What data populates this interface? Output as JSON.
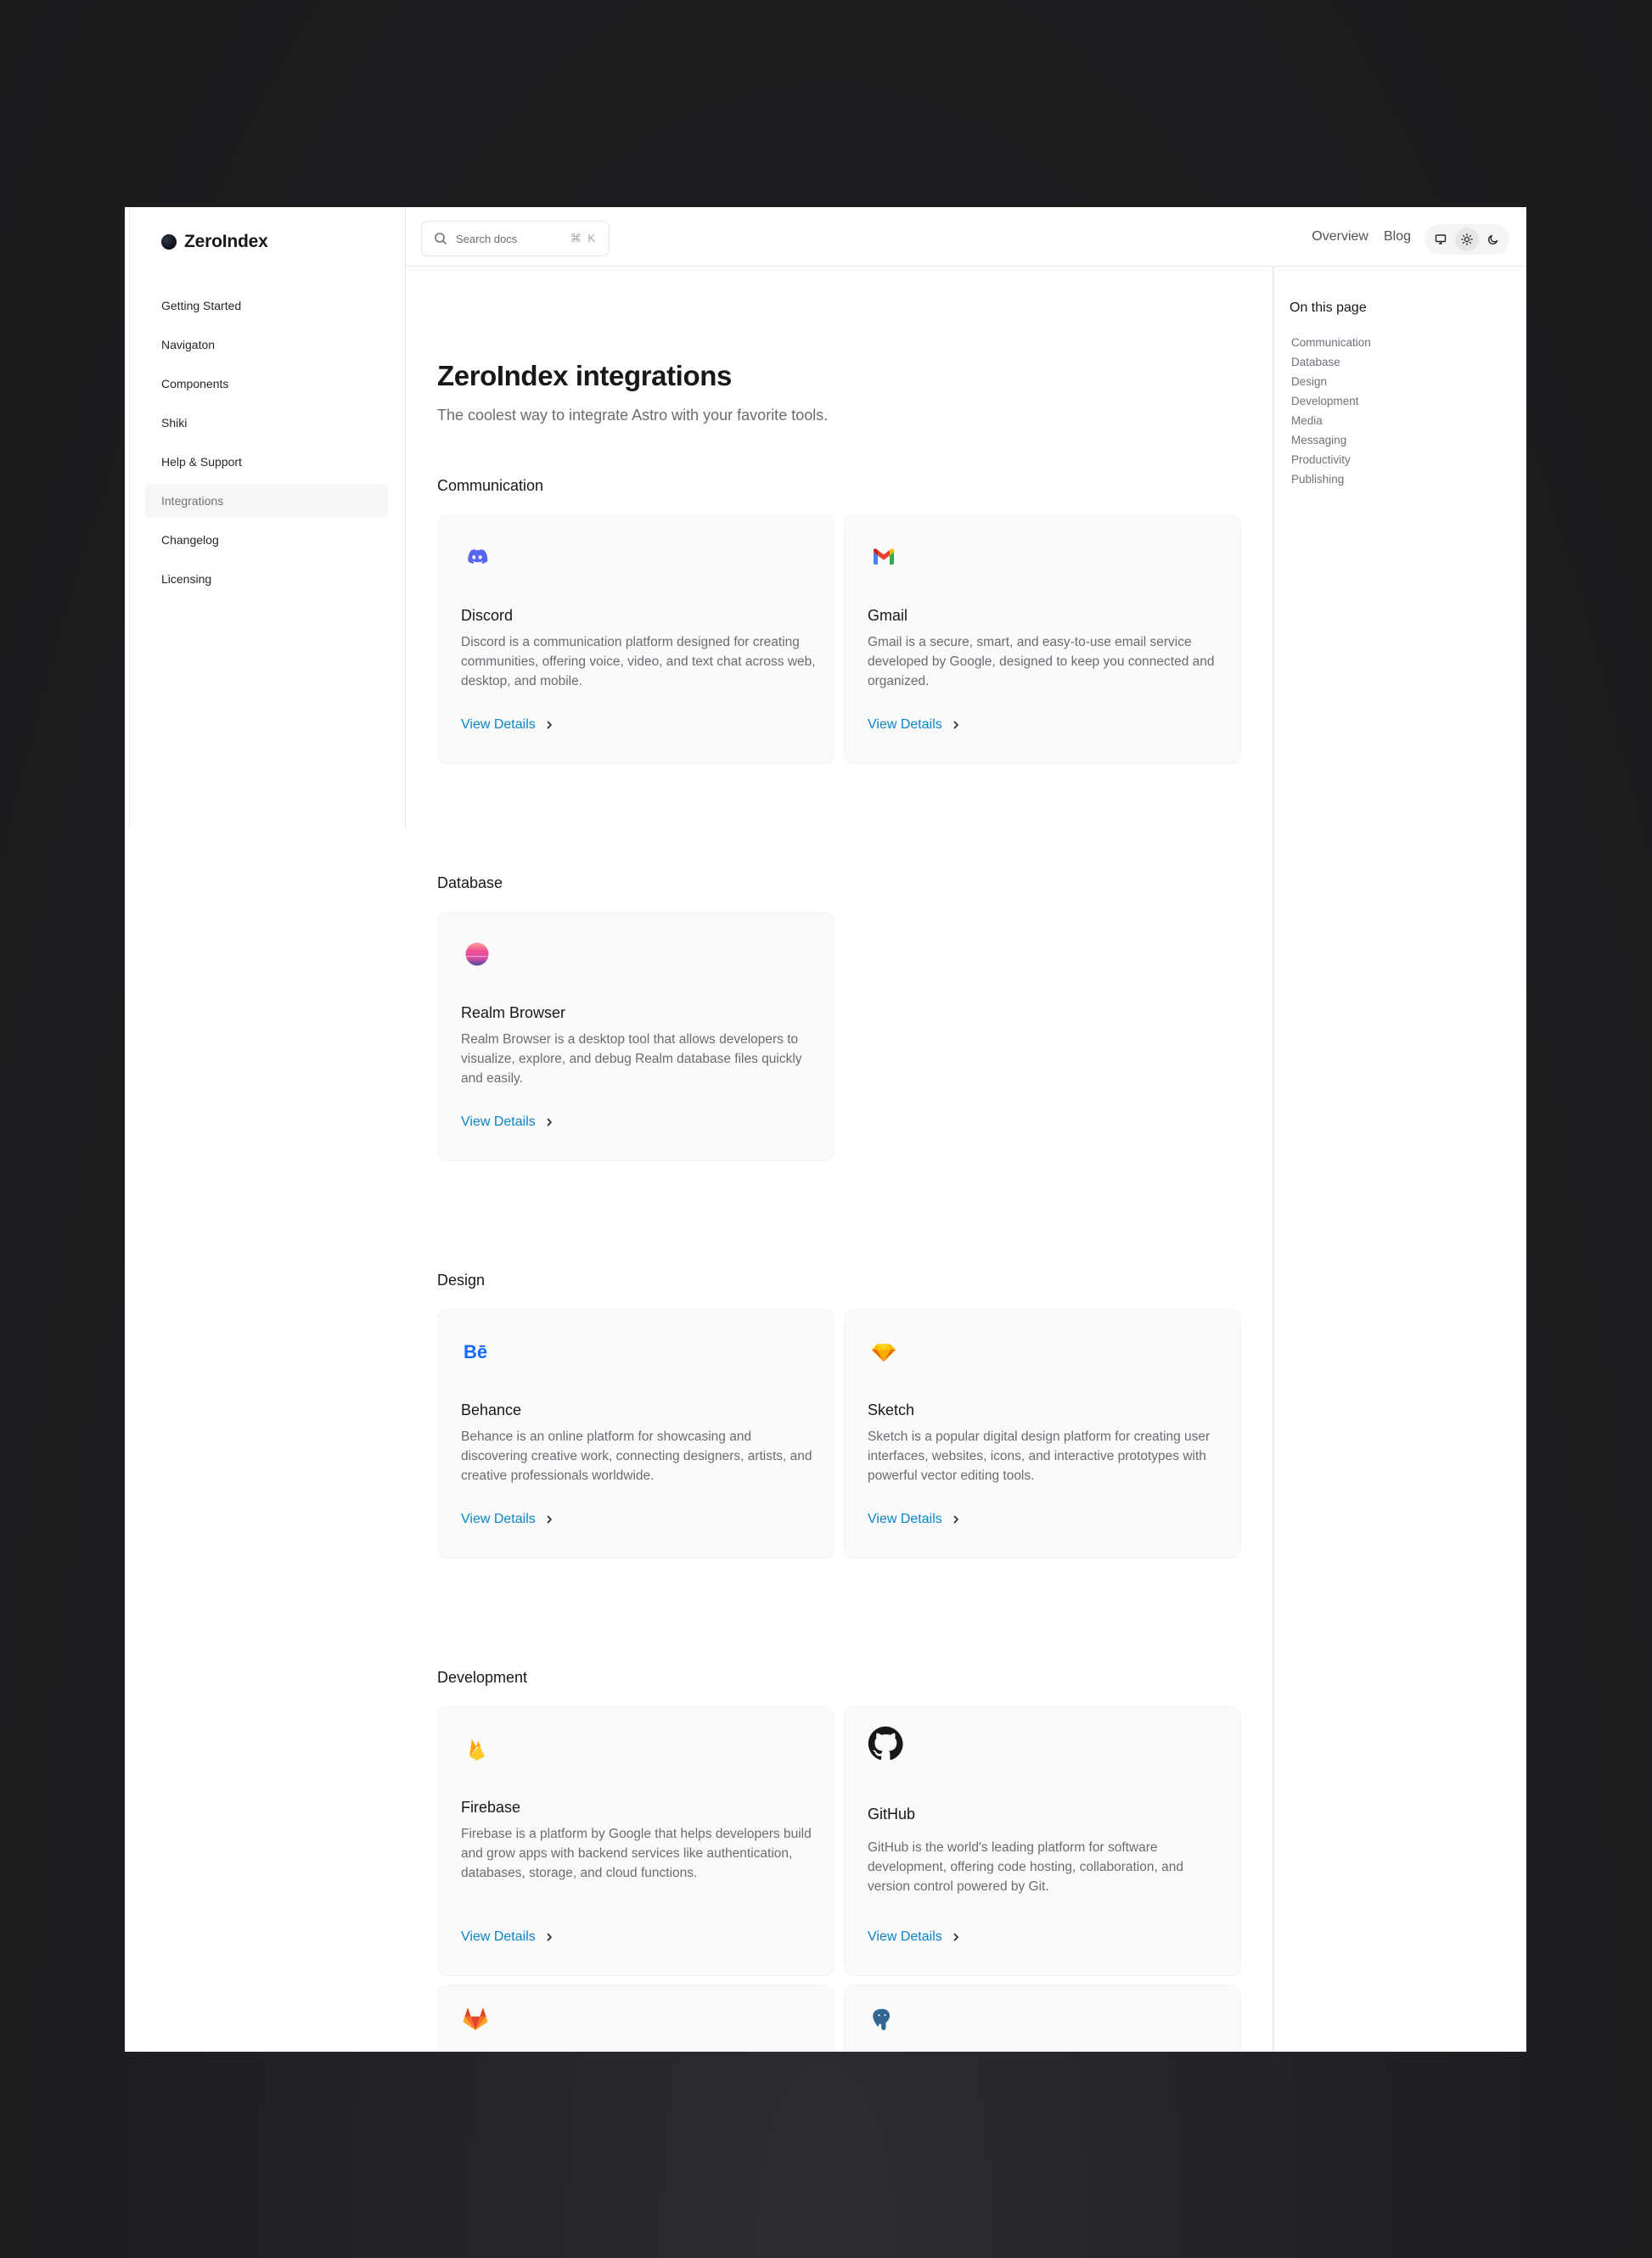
{
  "brand": {
    "name": "ZeroIndex"
  },
  "sidebar": {
    "items": [
      {
        "label": "Getting Started"
      },
      {
        "label": "Navigaton"
      },
      {
        "label": "Components"
      },
      {
        "label": "Shiki"
      },
      {
        "label": "Help & Support"
      },
      {
        "label": "Integrations",
        "active": true
      },
      {
        "label": "Changelog"
      },
      {
        "label": "Licensing"
      }
    ]
  },
  "topbar": {
    "search_placeholder": "Search docs",
    "search_shortcut": "⌘ K",
    "links": [
      "Overview",
      "Blog"
    ],
    "theme_options": [
      "monitor-icon",
      "sun-icon",
      "moon-icon"
    ],
    "theme_selected": "sun-icon"
  },
  "toc": {
    "title": "On this page",
    "items": [
      "Communication",
      "Database",
      "Design",
      "Development",
      "Media",
      "Messaging",
      "Productivity",
      "Publishing"
    ]
  },
  "page": {
    "title": "ZeroIndex integrations",
    "subtitle": "The coolest way to integrate Astro with your favorite tools."
  },
  "sections": [
    {
      "title": "Communication",
      "cards": [
        {
          "name": "Discord",
          "icon": "discord-icon",
          "desc": "Discord is a communication platform designed for creating communities, offering voice, video, and text chat across web, desktop, and mobile.",
          "link": "View Details"
        },
        {
          "name": "Gmail",
          "icon": "gmail-icon",
          "desc": "Gmail is a secure, smart, and easy-to-use email service developed by Google, designed to keep you connected and organized.",
          "link": "View Details"
        }
      ]
    },
    {
      "title": "Database",
      "cards": [
        {
          "name": "Realm Browser",
          "icon": "realm-icon",
          "desc": "Realm Browser is a desktop tool that allows developers to visualize, explore, and debug Realm database files quickly and easily.",
          "link": "View Details"
        }
      ]
    },
    {
      "title": "Design",
      "cards": [
        {
          "name": "Behance",
          "icon": "behance-icon",
          "desc": "Behance is an online platform for showcasing and discovering creative work, connecting designers, artists, and creative professionals worldwide.",
          "link": "View Details"
        },
        {
          "name": "Sketch",
          "icon": "sketch-icon",
          "desc": "Sketch is a popular digital design platform for creating user interfaces, websites, icons, and interactive prototypes with powerful vector editing tools.",
          "link": "View Details"
        }
      ]
    },
    {
      "title": "Development",
      "cards": [
        {
          "name": "Firebase",
          "icon": "firebase-icon",
          "desc": "Firebase is a platform by Google that helps developers build and grow apps with backend services like authentication, databases, storage, and cloud functions.",
          "link": "View Details"
        },
        {
          "name": "GitHub",
          "icon": "github-icon",
          "desc": "GitHub is the world's leading platform for software development, offering code hosting, collaboration, and version control powered by Git.",
          "link": "View Details"
        }
      ]
    }
  ],
  "colors": {
    "link": "#0a84c9",
    "card_bg": "#fafafa",
    "discord": "#5865f2",
    "behance": "#1769ff"
  }
}
